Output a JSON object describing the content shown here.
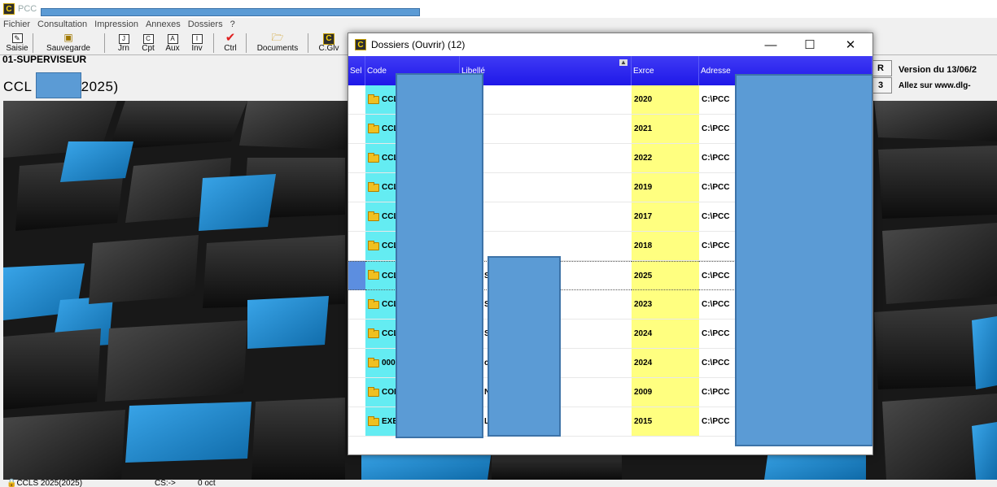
{
  "app": {
    "title": "PCC",
    "icon_letter": "C",
    "menu": [
      "Fichier",
      "Consultation",
      "Impression",
      "Annexes",
      "Dossiers",
      "?"
    ]
  },
  "toolbar": {
    "saisie": "Saisie",
    "sauvegarde": "Sauvegarde",
    "jrn": "Jrn",
    "cpt": "Cpt",
    "aux": "Aux",
    "inv": "Inv",
    "ctrl": "Ctrl",
    "documents": "Documents",
    "cglv": "C.Glv",
    "icons": {
      "jrn": "J",
      "cpt": "C",
      "aux": "A",
      "inv": "I"
    }
  },
  "user": "01-SUPERVISEUR",
  "dossier_left": "CCL",
  "dossier_right": "5(2025)",
  "right_panel": {
    "btn1": "R",
    "btn2": "3",
    "version": "Version du 13/06/2",
    "visit": "Allez sur  www.dlg-"
  },
  "status": {
    "dossier": "CCLS 2025(2025)",
    "cs": "CS:->",
    "oct": "0 oct"
  },
  "dialog": {
    "title": "Dossiers (Ouvrir)  (12)",
    "minimize": "—",
    "maximize": "☐",
    "close": "✕",
    "columns": {
      "sel": "Sel",
      "code": "Code",
      "libelle": "Libellé",
      "exercice": "Exrce",
      "adresse": "Adresse"
    },
    "rows": [
      {
        "code": "CCLS",
        "libelle": "",
        "exercice": "2020",
        "adresse": "C:\\PCC"
      },
      {
        "code": "CCLS",
        "libelle": "",
        "exercice": "2021",
        "adresse": "C:\\PCC"
      },
      {
        "code": "CCLS",
        "libelle": "",
        "exercice": "2022",
        "adresse": "C:\\PCC"
      },
      {
        "code": "CCLS",
        "libelle": "",
        "exercice": "2019",
        "adresse": "C:\\PCC"
      },
      {
        "code": "CCLS",
        "libelle": "",
        "exercice": "2017",
        "adresse": "C:\\PCC"
      },
      {
        "code": "CCLS",
        "libelle": "",
        "exercice": "2018",
        "adresse": "C:\\PCC"
      },
      {
        "code": "CCLS",
        "libelle": "S",
        "exercice": "2025",
        "adresse": "C:\\PCC"
      },
      {
        "code": "CCLS2",
        "libelle": "S",
        "exercice": "2023",
        "adresse": "C:\\PCC"
      },
      {
        "code": "CCLS",
        "libelle": "S",
        "exercice": "2024",
        "adresse": "C:\\PCC"
      },
      {
        "code": "00000",
        "libelle": "c",
        "exercice": "2024",
        "adresse": "C:\\PCC"
      },
      {
        "code": "COMP",
        "libelle": "N",
        "exercice": "2009",
        "adresse": "C:\\PCC"
      },
      {
        "code": "EXEMF",
        "libelle": "L",
        "exercice": "2015",
        "adresse": "C:\\PCC"
      }
    ],
    "selected_row": 6
  },
  "colors": {
    "header_blue": "#2a24ef",
    "code_cyan": "#64ecf2",
    "exercice_yellow": "#ffff80",
    "redaction_blue": "#5b9bd5",
    "cube_blue": "#1f8fd6"
  }
}
